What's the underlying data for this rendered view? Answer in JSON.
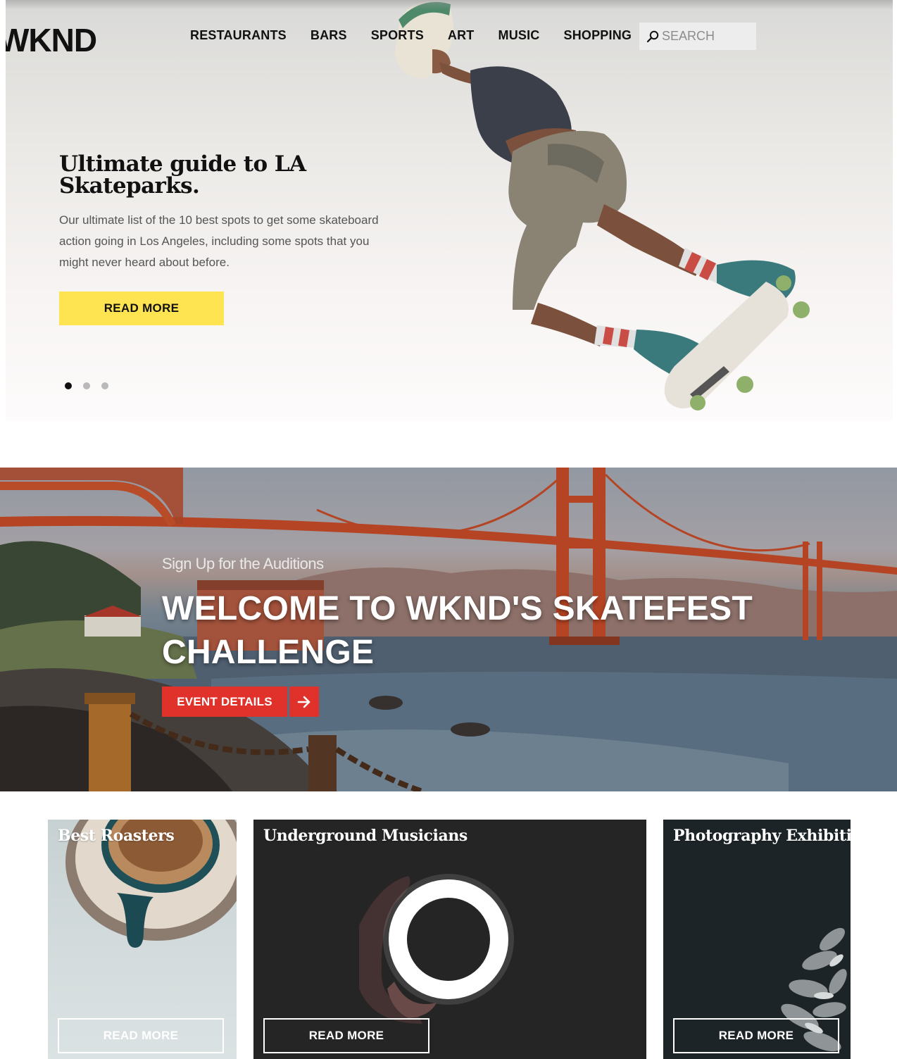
{
  "header": {
    "logo": "WKND",
    "nav": [
      "RESTAURANTS",
      "BARS",
      "SPORTS",
      "ART",
      "MUSIC",
      "SHOPPING"
    ],
    "search_placeholder": "SEARCH",
    "search_icon": "search-icon"
  },
  "hero": {
    "title": "Ultimate guide to LA Skateparks.",
    "description": "Our ultimate list of the 10 best spots to get some skateboard action going in Los Angeles, including some spots that you might never heard about before.",
    "button": "READ MORE",
    "slides": 3,
    "active_slide": 1,
    "accent_color": "#fee451"
  },
  "banner": {
    "subtitle": "Sign Up for the Auditions",
    "title": "WELCOME TO WKND'S SKATEFEST CHALLENGE",
    "button": "EVENT DETAILS",
    "button_icon": "arrow-right-icon",
    "button_color": "#e0312b"
  },
  "cards": [
    {
      "title": "Best Roasters",
      "button": "READ MORE"
    },
    {
      "title": "Underground Musicians",
      "button": "READ MORE"
    },
    {
      "title": "Photography Exhibitions",
      "button": "READ MORE"
    }
  ]
}
